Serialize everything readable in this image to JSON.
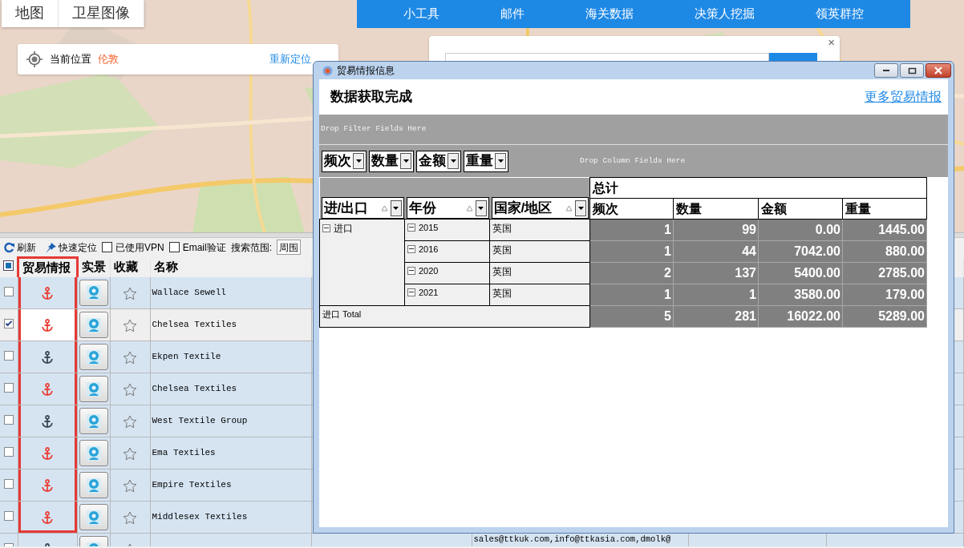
{
  "map_view": {
    "tabs": [
      "地图",
      "卫星图像"
    ]
  },
  "location": {
    "label": "当前位置",
    "city": "伦敦",
    "relocate": "重新定位"
  },
  "top_nav": [
    "小工具",
    "邮件",
    "海关数据",
    "决策人挖掘",
    "领英群控"
  ],
  "search_panel": {
    "close": "×"
  },
  "toolbar": {
    "refresh": "刷新",
    "locate": "快速定位",
    "options": [
      {
        "label": "已使用VPN",
        "checked": false
      },
      {
        "label": "Email验证",
        "checked": false
      }
    ],
    "scope_label": "搜索范围:",
    "scope_value": "周围"
  },
  "table": {
    "select_all_partial": true,
    "columns": [
      {
        "label": "贸易情报",
        "highlighted": true
      },
      {
        "label": "实景",
        "highlighted": false
      },
      {
        "label": "收藏",
        "highlighted": false
      },
      {
        "label": "名称",
        "highlighted": false
      }
    ],
    "rows": [
      {
        "name": "Wallace Sewell",
        "checked": false,
        "selected": false,
        "has_intel": true,
        "framed": true
      },
      {
        "name": "Chelsea Textiles",
        "checked": true,
        "selected": true,
        "has_intel": true,
        "framed": true
      },
      {
        "name": "Ekpen Textile",
        "checked": false,
        "selected": false,
        "has_intel": false,
        "framed": true
      },
      {
        "name": "Chelsea Textiles",
        "checked": false,
        "selected": false,
        "has_intel": true,
        "framed": true
      },
      {
        "name": "West Textile Group",
        "checked": false,
        "selected": false,
        "has_intel": false,
        "framed": true
      },
      {
        "name": "Ema Textiles",
        "checked": false,
        "selected": false,
        "has_intel": true,
        "framed": true
      },
      {
        "name": "Empire Textiles",
        "checked": false,
        "selected": false,
        "has_intel": true,
        "framed": true
      },
      {
        "name": "Middlesex Textiles",
        "checked": false,
        "selected": false,
        "has_intel": true,
        "framed": true
      },
      {
        "checked": false,
        "selected": false,
        "has_intel": false,
        "framed": false,
        "email": "sales@ttkuk.com,info@ttkasia.com,dmolk@"
      }
    ]
  },
  "dialog": {
    "title": "贸易情报信息",
    "status": "数据获取完成",
    "more_link": "更多贸易情报",
    "filter_hint": "Drop Filter Fields Here",
    "column_hint": "Drop Column Fields Here",
    "data_fields": [
      "频次",
      "数量",
      "金额",
      "重量"
    ],
    "row_fields": [
      "进/出口",
      "年份",
      "国家/地区"
    ],
    "grand_label": "总计",
    "measures": [
      "频次",
      "数量",
      "金额",
      "重量"
    ],
    "groups": [
      {
        "label": "进口",
        "expanded": true,
        "years": [
          {
            "year": "2015",
            "expanded": true,
            "country": "英国",
            "values": [
              "1",
              "99",
              "0.00",
              "1445.00"
            ]
          },
          {
            "year": "2016",
            "expanded": true,
            "country": "英国",
            "values": [
              "1",
              "44",
              "7042.00",
              "880.00"
            ]
          },
          {
            "year": "2020",
            "expanded": true,
            "country": "英国",
            "values": [
              "2",
              "137",
              "5400.00",
              "2785.00"
            ]
          },
          {
            "year": "2021",
            "expanded": true,
            "country": "英国",
            "values": [
              "1",
              "1",
              "3580.00",
              "179.00"
            ]
          }
        ],
        "total_label": "进口 Total",
        "total_values": [
          "5",
          "281",
          "16022.00",
          "5289.00"
        ]
      }
    ]
  }
}
